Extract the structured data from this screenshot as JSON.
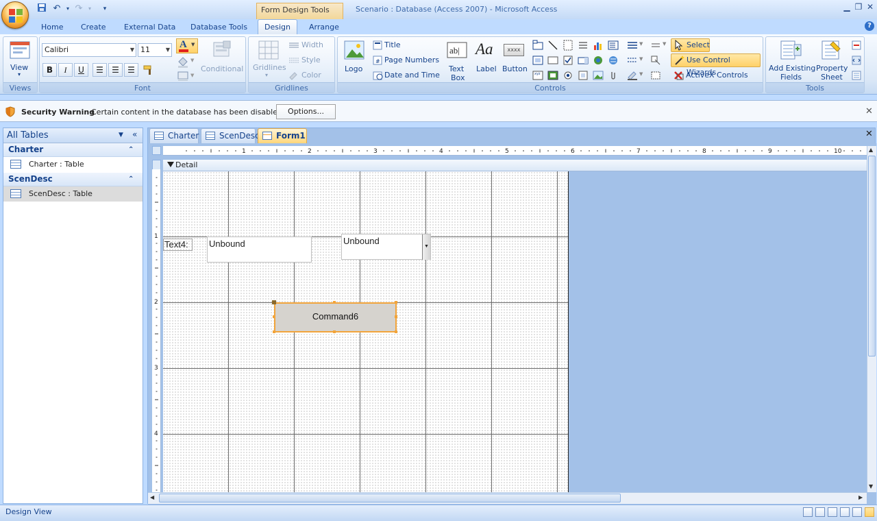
{
  "window": {
    "title": "Scenario : Database (Access 2007) - Microsoft Access",
    "contextual_tab_set": "Form Design Tools",
    "minimize_icon": "minimize-icon",
    "maximize_icon": "maximize-icon",
    "close_icon": "close-icon"
  },
  "ribbon_tabs": [
    "Home",
    "Create",
    "External Data",
    "Database Tools",
    "Design",
    "Arrange"
  ],
  "active_tab": "Design",
  "ribbon": {
    "views": {
      "title": "Views",
      "view_label": "View"
    },
    "font": {
      "title": "Font",
      "font_name": "Calibri",
      "font_size": "11",
      "bold": "B",
      "italic": "I",
      "underline": "U",
      "conditional": "Conditional",
      "font_color": "#e0211c"
    },
    "gridlines": {
      "title": "Gridlines",
      "gridlines_label": "Gridlines",
      "width": "Width",
      "style": "Style",
      "color": "Color"
    },
    "controls": {
      "title": "Controls",
      "logo": "Logo",
      "title_btn": "Title",
      "page_numbers": "Page Numbers",
      "date_time": "Date and Time",
      "text_box": "Text Box",
      "text_box_l1": "Text",
      "text_box_l2": "Box",
      "label": "Label",
      "button": "Button",
      "select": "Select",
      "use_control_wizards": "Use Control Wizards",
      "activex": "ActiveX Controls"
    },
    "tools": {
      "title": "Tools",
      "add_fields_l1": "Add Existing",
      "add_fields_l2": "Fields",
      "property_l1": "Property",
      "property_l2": "Sheet"
    }
  },
  "security": {
    "title": "Security Warning",
    "message": "Certain content in the database has been disabled",
    "options_label": "Options..."
  },
  "nav_pane": {
    "header": "All Tables",
    "groups": [
      {
        "name": "Charter",
        "items": [
          "Charter : Table"
        ]
      },
      {
        "name": "ScenDesc",
        "items": [
          "ScenDesc : Table"
        ]
      }
    ]
  },
  "doc_tabs": [
    "Charter",
    "ScenDesc",
    "Form1"
  ],
  "active_doc_tab": "Form1",
  "ruler_h": [
    "1",
    "2",
    "3",
    "4",
    "5",
    "6",
    "7",
    "8",
    "9",
    "10"
  ],
  "ruler_v": [
    "1",
    "2",
    "3",
    "4"
  ],
  "form": {
    "section": "Detail",
    "label_text": "Text4:",
    "textbox_value": "Unbound",
    "combobox_value": "Unbound",
    "command_button": "Command6"
  },
  "status_bar": {
    "text": "Design View"
  },
  "colors": {
    "accent": "#f2a43a",
    "ribbon_text": "#15428b",
    "canvas_bg": "#a3c1e8"
  }
}
